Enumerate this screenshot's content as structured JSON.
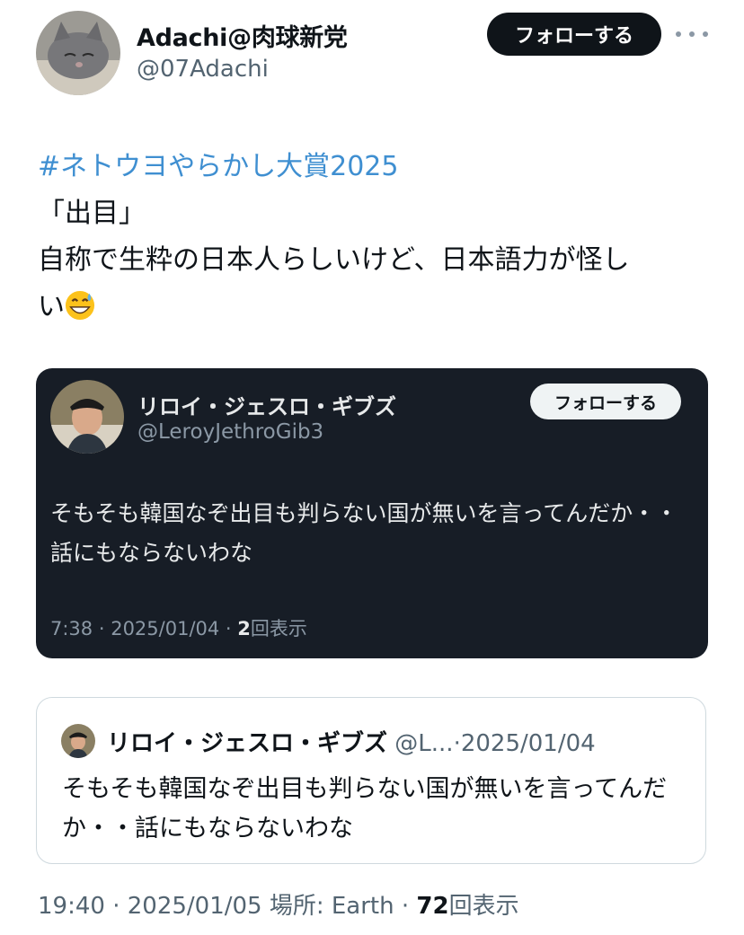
{
  "author": {
    "display_name": "Adachi@肉球新党",
    "handle": "@07Adachi",
    "follow_label": "フォローする"
  },
  "tweet": {
    "hashtag": "#ネトウヨやらかし大賞2025",
    "line1": "「出目」",
    "line2": "自称で生粋の日本人らしいけど、日本語力が怪し",
    "line3": "い",
    "emoji": "grinning-sweat-emoji"
  },
  "media_card": {
    "display_name": "リロイ・ジェスロ・ギブズ",
    "handle": "@LeroyJethroGib3",
    "follow_label": "フォローする",
    "text": "そもそも韓国なぞ出目も判らない国が無いを言ってんだか・・話にもならないわな",
    "time": "7:38",
    "date": "2025/01/04",
    "views_count": "2",
    "views_label": "回表示"
  },
  "quote": {
    "display_name": "リロイ・ジェスロ・ギブズ",
    "handle": "@L...",
    "date": "2025/01/04",
    "text": "そもそも韓国なぞ出目も判らない国が無いを言ってんだか・・話にもならないわな"
  },
  "footer": {
    "time": "19:40",
    "date": "2025/01/05",
    "location": "場所: Earth",
    "views_count": "72",
    "views_label": "回表示"
  },
  "colors": {
    "hashtag": "#3f8fd1",
    "card_bg": "#171d26",
    "follow_bg": "#0f1419"
  }
}
